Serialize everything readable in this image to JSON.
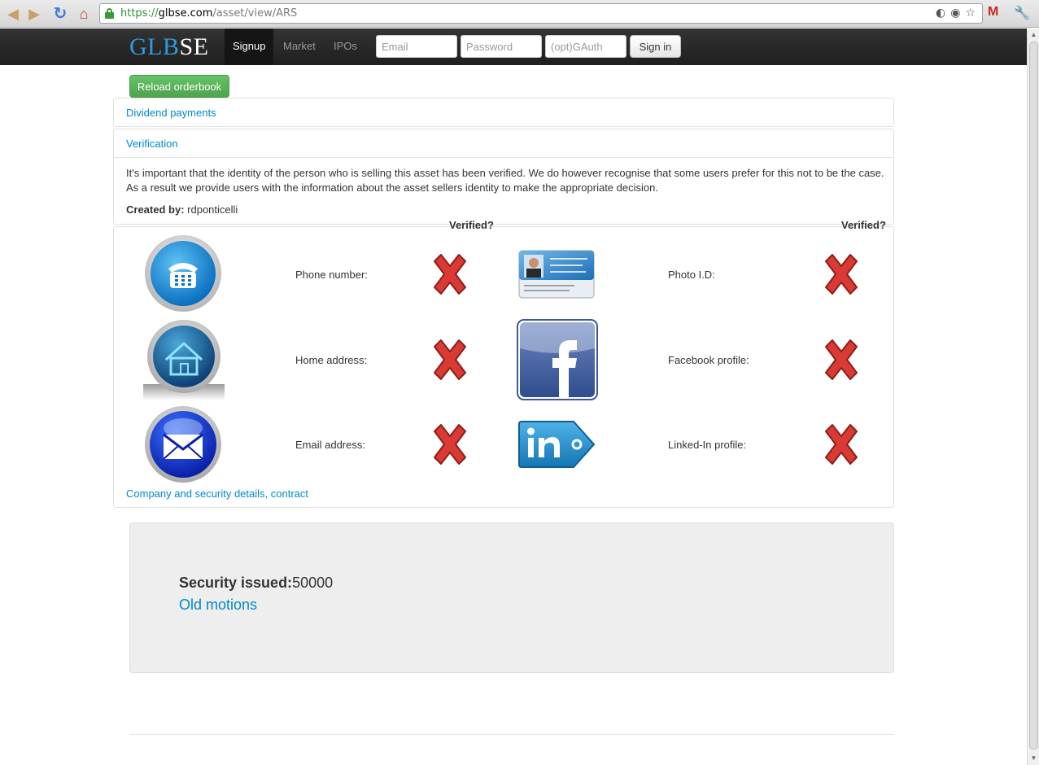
{
  "browser": {
    "url_scheme": "https://",
    "url_host": "glbse.com",
    "url_path": "/asset/view/ARS"
  },
  "navbar": {
    "brand_part1": "GLB",
    "brand_part2": "SE",
    "items": [
      {
        "label": "Signup",
        "active": true
      },
      {
        "label": "Market",
        "active": false
      },
      {
        "label": "IPOs",
        "active": false
      }
    ],
    "email_placeholder": "Email",
    "password_placeholder": "Password",
    "gauth_placeholder": "(opt)GAuth",
    "signin_label": "Sign in"
  },
  "content": {
    "reload_label": "Reload orderbook",
    "dividend_link": "Dividend payments",
    "verification_link": "Verification",
    "verification_text": "It's important that the identity of the person who is selling this asset has been verified. We do however recognise that some users prefer for this not to be the case. As a result we provide users with the information about the asset sellers identity to make the appropriate decision.",
    "created_by_label": "Created by:",
    "created_by_value": "rdponticelli",
    "verified_header": "Verified?",
    "verification_rows": [
      {
        "label": "Phone number:",
        "icon": "telephone-icon",
        "verified": false
      },
      {
        "label": "Photo I.D:",
        "icon": "photo-id-icon",
        "verified": false
      },
      {
        "label": "Home address:",
        "icon": "home-icon",
        "verified": false
      },
      {
        "label": "Facebook profile:",
        "icon": "facebook-icon",
        "verified": false
      },
      {
        "label": "Email address:",
        "icon": "email-icon",
        "verified": false
      },
      {
        "label": "Linked-In profile:",
        "icon": "linkedin-icon",
        "verified": false
      }
    ],
    "company_link": "Company and security details, contract",
    "security_issued_label": "Security issued:",
    "security_issued_value": "50000",
    "old_motions_link": "Old motions"
  },
  "colors": {
    "link": "#0088cc",
    "brand_blue": "#2f9bdc",
    "reload_green": "#5bb75b",
    "cross_red": "#d93a33"
  }
}
